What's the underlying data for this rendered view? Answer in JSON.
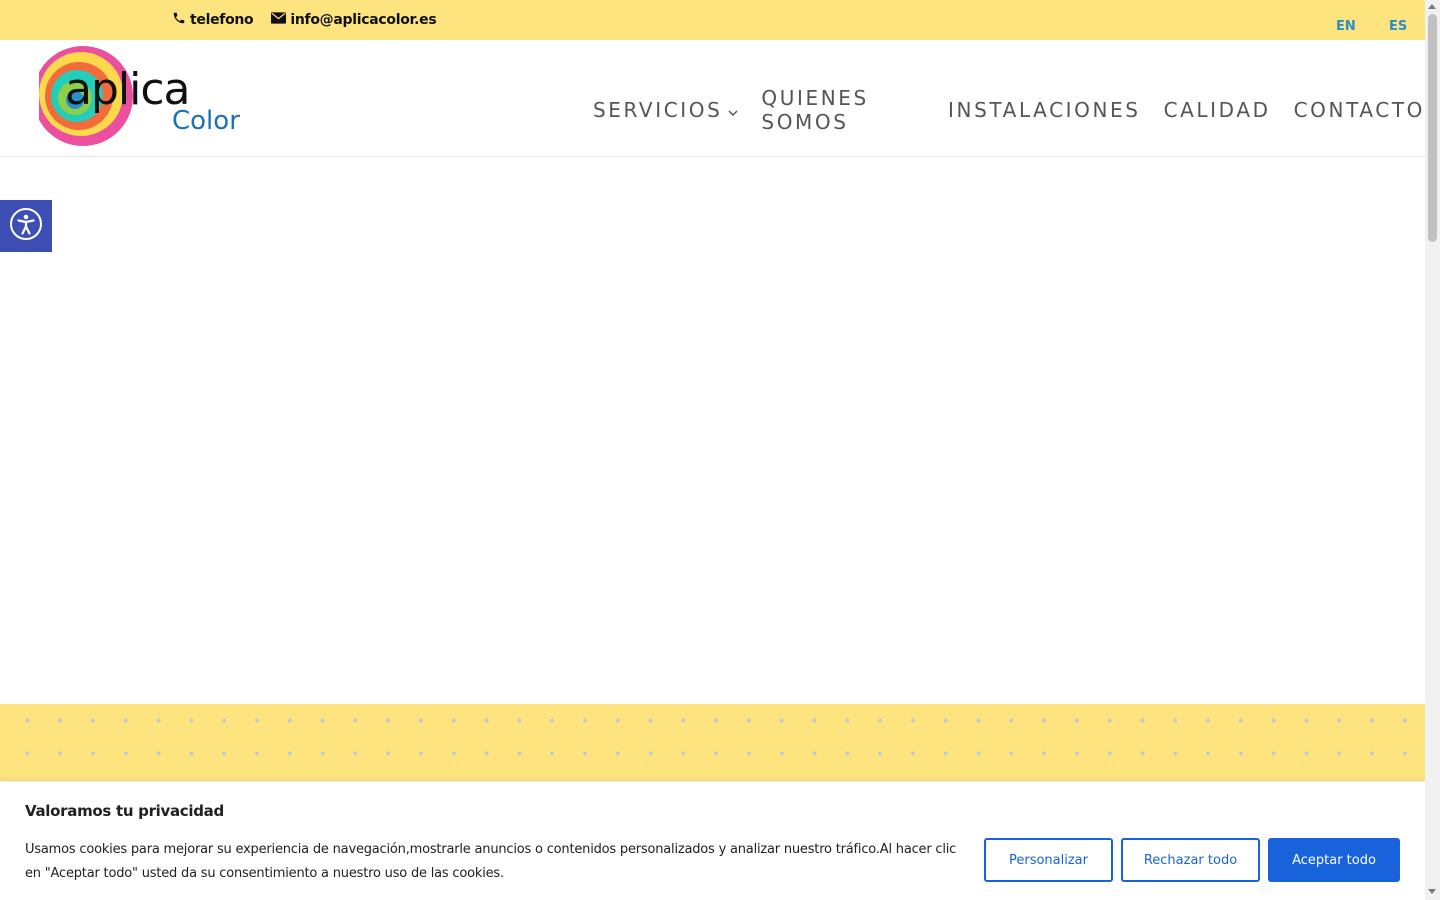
{
  "topbar": {
    "phone_label": "telefono",
    "email_label": "info@aplicacolor.es",
    "languages": [
      "EN",
      "ES"
    ]
  },
  "brand": {
    "logo_text_main": "aplica",
    "logo_text_sub": "Color"
  },
  "nav": {
    "items": [
      "SERVICIOS",
      "QUIENES SOMOS",
      "INSTALACIONES",
      "CALIDAD",
      "CONTACTO"
    ]
  },
  "cookie": {
    "title": "Valoramos tu privacidad",
    "text": "Usamos cookies para mejorar su experiencia de navegación,mostrarle anuncios o contenidos personalizados y analizar nuestro tráfico.Al hacer clic en \"Aceptar todo\" usted da su consentimiento a nuestro uso de las cookies.",
    "customize_label": "Personalizar",
    "reject_label": "Rechazar todo",
    "accept_label": "Aceptar todo"
  },
  "colors": {
    "topbar_bg": "#fde47f",
    "nav_text": "#555555",
    "lang_link": "#2a8fc9",
    "accessibility_bg": "#3d4fb3",
    "cookie_accent": "#1863dc"
  },
  "icons": [
    "phone-icon",
    "envelope-icon",
    "chevron-down-icon",
    "accessibility-icon"
  ]
}
